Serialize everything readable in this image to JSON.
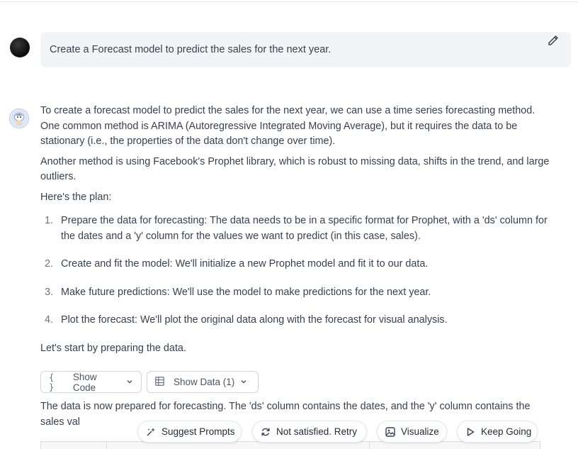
{
  "user_message": {
    "text": "Create a Forecast model to predict the sales for the next year."
  },
  "assistant": {
    "paragraphs": [
      "To create a forecast model to predict the sales for the next year, we can use a time series forecasting method. One common method is ARIMA (Autoregressive Integrated Moving Average), but it requires the data to be stationary (i.e., the properties of the data don't change over time).",
      "Another method is using Facebook's Prophet library, which is robust to missing data, shifts in the trend, and large outliers.",
      "Here's the plan:"
    ],
    "plan": [
      {
        "num": "1.",
        "text": "Prepare the data for forecasting: The data needs to be in a specific format for Prophet, with a 'ds' column for the dates and a 'y' column for the values we want to predict (in this case, sales)."
      },
      {
        "num": "2.",
        "text": "Create and fit the model: We'll initialize a new Prophet model and fit it to our data."
      },
      {
        "num": "3.",
        "text": "Make future predictions: We'll use the model to make predictions for the next year."
      },
      {
        "num": "4.",
        "text": "Plot the forecast: We'll plot the original data along with the forecast for visual analysis."
      }
    ],
    "after_plan": "Let's start by preparing the data.",
    "show_code_label": "Show Code",
    "show_code_icon": "{ }",
    "show_data_label": "Show Data (1)",
    "continuation": "The data is now prepared for forecasting. The 'ds' column contains the dates, and the 'y' column contains the sales val"
  },
  "actions": {
    "suggest": "Suggest Prompts",
    "retry": "Not satisfied. Retry",
    "visualize": "Visualize",
    "keep_going": "Keep Going"
  }
}
